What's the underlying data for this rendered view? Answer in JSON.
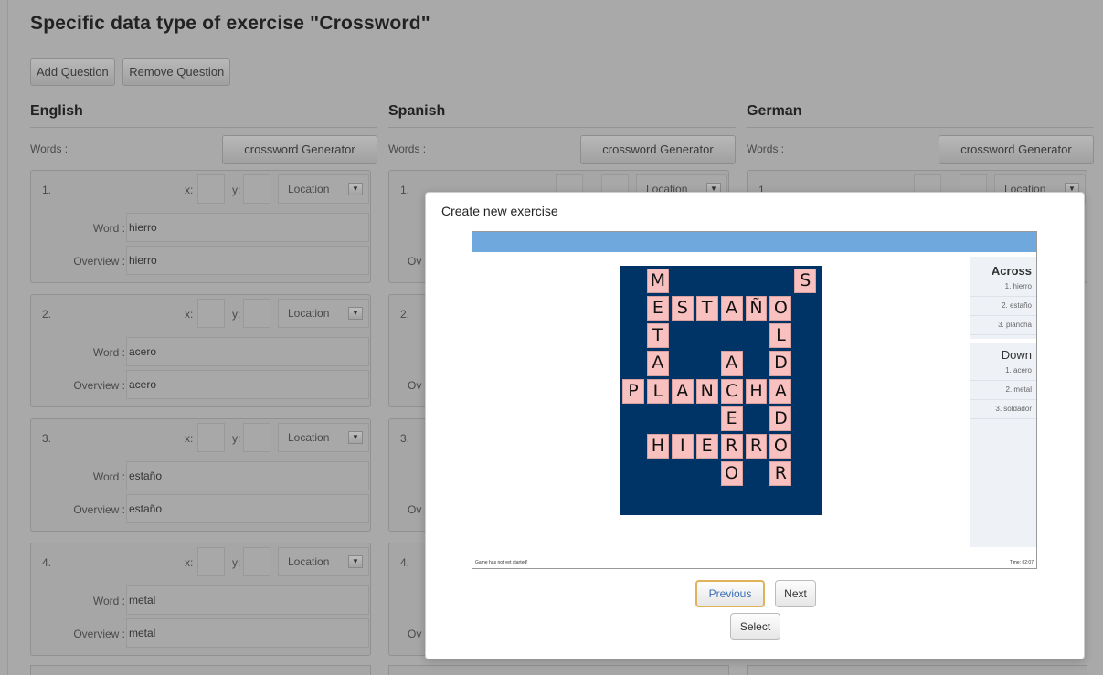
{
  "page": {
    "title": "Specific data type of exercise \"Crossword\"",
    "add_question": "Add Question",
    "remove_question": "Remove Question"
  },
  "columns": [
    {
      "title": "English",
      "words_label": "Words :",
      "generator_label": "crossword Generator",
      "questions": [
        {
          "num": "1.",
          "x": "",
          "y": "",
          "location": "Location",
          "word": "hierro",
          "overview": "hierro"
        },
        {
          "num": "2.",
          "x": "",
          "y": "",
          "location": "Location",
          "word": "acero",
          "overview": "acero"
        },
        {
          "num": "3.",
          "x": "",
          "y": "",
          "location": "Location",
          "word": "estaño",
          "overview": "estaño"
        },
        {
          "num": "4.",
          "x": "",
          "y": "",
          "location": "Location",
          "word": "metal",
          "overview": "metal"
        }
      ]
    },
    {
      "title": "Spanish",
      "words_label": "Words :",
      "generator_label": "crossword Generator",
      "questions": [
        {
          "num": "1.",
          "location": "Location"
        },
        {
          "num": "2."
        },
        {
          "num": "3."
        },
        {
          "num": "4."
        }
      ]
    },
    {
      "title": "German",
      "words_label": "Words :",
      "generator_label": "crossword Generator",
      "questions": [
        {
          "num": "1.",
          "location": "Location"
        }
      ]
    }
  ],
  "labels": {
    "x": "x:",
    "y": "y:",
    "word": "Word :",
    "overview": "Overview :",
    "overview_short": "Ov"
  },
  "modal": {
    "title": "Create new exercise",
    "across_title": "Across",
    "across": [
      "1. hierro",
      "2. estaño",
      "3. plancha"
    ],
    "down_title": "Down",
    "down": [
      "1. acero",
      "2. metal",
      "3. soldador"
    ],
    "status_left": "Game has not yet started!",
    "status_right": "Time: 02:07",
    "previous": "Previous",
    "next": "Next",
    "select": "Select"
  },
  "crossword": {
    "rows": 9,
    "cols": 8,
    "cells": [
      {
        "r": 0,
        "c": 1,
        "ch": "M"
      },
      {
        "r": 0,
        "c": 7,
        "ch": "S"
      },
      {
        "r": 1,
        "c": 1,
        "ch": "E"
      },
      {
        "r": 1,
        "c": 2,
        "ch": "S"
      },
      {
        "r": 1,
        "c": 3,
        "ch": "T"
      },
      {
        "r": 1,
        "c": 4,
        "ch": "A"
      },
      {
        "r": 1,
        "c": 5,
        "ch": "Ñ"
      },
      {
        "r": 1,
        "c": 6,
        "ch": "O"
      },
      {
        "r": 2,
        "c": 1,
        "ch": "T"
      },
      {
        "r": 2,
        "c": 6,
        "ch": "L"
      },
      {
        "r": 3,
        "c": 1,
        "ch": "A"
      },
      {
        "r": 3,
        "c": 4,
        "ch": "A"
      },
      {
        "r": 3,
        "c": 6,
        "ch": "D"
      },
      {
        "r": 4,
        "c": 0,
        "ch": "P"
      },
      {
        "r": 4,
        "c": 1,
        "ch": "L"
      },
      {
        "r": 4,
        "c": 2,
        "ch": "A"
      },
      {
        "r": 4,
        "c": 3,
        "ch": "N"
      },
      {
        "r": 4,
        "c": 4,
        "ch": "C"
      },
      {
        "r": 4,
        "c": 5,
        "ch": "H"
      },
      {
        "r": 4,
        "c": 6,
        "ch": "A"
      },
      {
        "r": 5,
        "c": 4,
        "ch": "E"
      },
      {
        "r": 5,
        "c": 6,
        "ch": "D"
      },
      {
        "r": 6,
        "c": 1,
        "ch": "H"
      },
      {
        "r": 6,
        "c": 2,
        "ch": "I"
      },
      {
        "r": 6,
        "c": 3,
        "ch": "E"
      },
      {
        "r": 6,
        "c": 4,
        "ch": "R"
      },
      {
        "r": 6,
        "c": 5,
        "ch": "R"
      },
      {
        "r": 6,
        "c": 6,
        "ch": "O"
      },
      {
        "r": 7,
        "c": 4,
        "ch": "O"
      },
      {
        "r": 7,
        "c": 6,
        "ch": "R"
      }
    ]
  }
}
